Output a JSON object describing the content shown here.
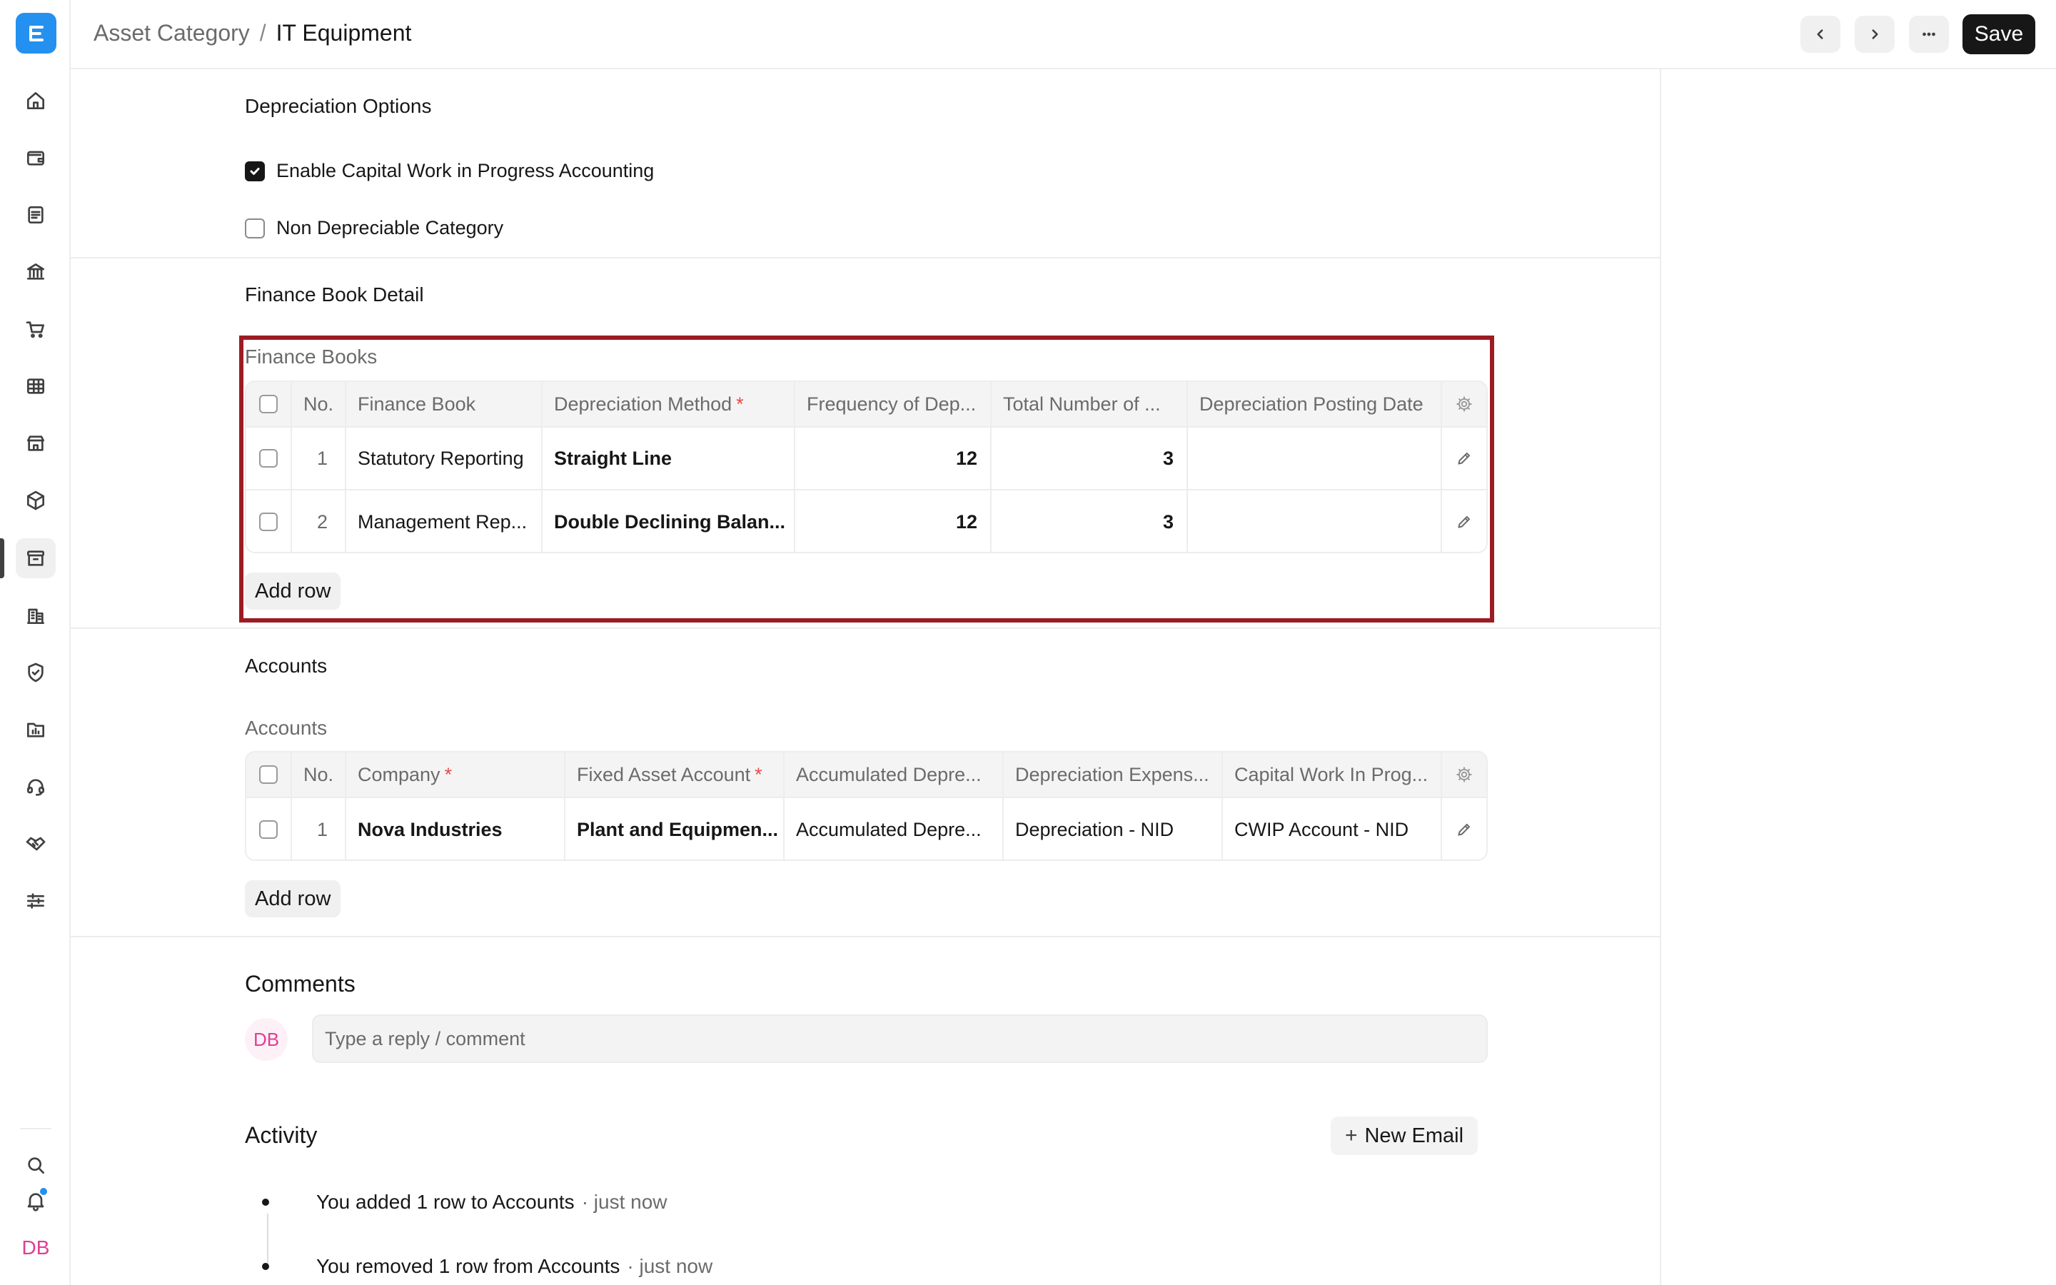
{
  "app": {
    "logo_letter": "E",
    "accent": "#2490ef"
  },
  "sidebar": {
    "items": [
      {
        "icon": "home-icon"
      },
      {
        "icon": "wallet-icon"
      },
      {
        "icon": "document-icon"
      },
      {
        "icon": "bank-icon"
      },
      {
        "icon": "cart-icon"
      },
      {
        "icon": "table-icon"
      },
      {
        "icon": "store-icon"
      },
      {
        "icon": "package-icon"
      },
      {
        "icon": "archive-icon"
      },
      {
        "icon": "building-icon"
      },
      {
        "icon": "shield-check-icon"
      },
      {
        "icon": "folder-chart-icon"
      },
      {
        "icon": "headset-icon"
      },
      {
        "icon": "handshake-icon"
      },
      {
        "icon": "sliders-icon"
      }
    ],
    "active_index": 8,
    "user_initials": "DB"
  },
  "header": {
    "breadcrumb_parent": "Asset Category",
    "breadcrumb_separator": "/",
    "breadcrumb_current": "IT Equipment",
    "save_label": "Save"
  },
  "depreciation_options": {
    "title": "Depreciation Options",
    "cwip_label": "Enable Capital Work in Progress Accounting",
    "cwip_checked": true,
    "non_depreciable_label": "Non Depreciable Category",
    "non_depreciable_checked": false
  },
  "finance_book_detail": {
    "title": "Finance Book Detail",
    "table_label": "Finance Books",
    "columns": {
      "no": "No.",
      "finance_book": "Finance Book",
      "depreciation_method": "Depreciation Method",
      "frequency": "Frequency of Dep...",
      "total_number": "Total Number of ...",
      "posting_date": "Depreciation Posting Date"
    },
    "required_mark": "*",
    "rows": [
      {
        "no": "1",
        "finance_book": "Statutory Reporting",
        "depreciation_method": "Straight Line",
        "frequency": "12",
        "total_number": "3",
        "posting_date": ""
      },
      {
        "no": "2",
        "finance_book": "Management Rep...",
        "depreciation_method": "Double Declining Balan...",
        "frequency": "12",
        "total_number": "3",
        "posting_date": ""
      }
    ],
    "add_row_label": "Add row"
  },
  "accounts": {
    "title": "Accounts",
    "table_label": "Accounts",
    "columns": {
      "no": "No.",
      "company": "Company",
      "fixed_asset_account": "Fixed Asset Account",
      "accumulated": "Accumulated Depre...",
      "expense": "Depreciation Expens...",
      "cwip": "Capital Work In Prog..."
    },
    "rows": [
      {
        "no": "1",
        "company": "Nova Industries",
        "fixed_asset_account": "Plant and Equipmen...",
        "accumulated": "Accumulated Depre...",
        "expense": "Depreciation - NID",
        "cwip": "CWIP Account - NID"
      }
    ],
    "add_row_label": "Add row"
  },
  "comments": {
    "title": "Comments",
    "avatar_initials": "DB",
    "placeholder": "Type a reply / comment"
  },
  "activity": {
    "title": "Activity",
    "new_email_plus": "+",
    "new_email_label": "New Email",
    "items": [
      {
        "text": "You added 1 row to Accounts",
        "time": "· just now"
      },
      {
        "text": "You removed 1 row from Accounts",
        "time": "· just now"
      }
    ]
  }
}
